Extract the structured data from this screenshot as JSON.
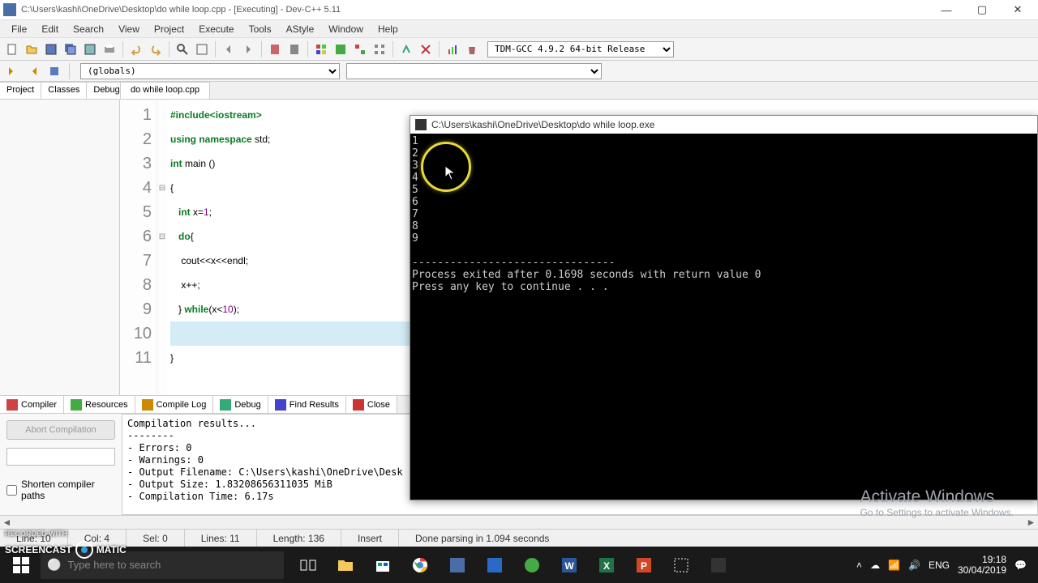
{
  "title": "C:\\Users\\kashi\\OneDrive\\Desktop\\do while loop.cpp - [Executing] - Dev-C++ 5.11",
  "menus": [
    "File",
    "Edit",
    "Search",
    "View",
    "Project",
    "Execute",
    "Tools",
    "AStyle",
    "Window",
    "Help"
  ],
  "compiler_select": "TDM-GCC 4.9.2 64-bit Release",
  "globals": "(globals)",
  "left_tabs": [
    "Project",
    "Classes",
    "Debug"
  ],
  "editor_tab": "do while loop.cpp",
  "code": {
    "lines": [
      {
        "n": "1",
        "html": "<span class='pp'>#include&lt;iostream&gt;</span>"
      },
      {
        "n": "2",
        "html": "<span class='kw'>using</span> <span class='kw'>namespace</span> std;"
      },
      {
        "n": "3",
        "html": "<span class='kw'>int</span> main ()"
      },
      {
        "n": "4",
        "html": "{",
        "fold": "⊟"
      },
      {
        "n": "5",
        "html": "   <span class='kw'>int</span> x=<span class='num'>1</span>;"
      },
      {
        "n": "6",
        "html": "   <span class='kw'>do</span>{",
        "fold": "⊟"
      },
      {
        "n": "7",
        "html": "    cout&lt;&lt;x&lt;&lt;endl;"
      },
      {
        "n": "8",
        "html": "    x++;"
      },
      {
        "n": "9",
        "html": "   } <span class='kw'>while</span>(x&lt;<span class='num'>10</span>);"
      },
      {
        "n": "10",
        "html": "",
        "current": true
      },
      {
        "n": "11",
        "html": "}"
      }
    ]
  },
  "console": {
    "title": "C:\\Users\\kashi\\OneDrive\\Desktop\\do while loop.exe",
    "body": "1\n2\n3\n4\n5\n6\n7\n8\n9\n\n--------------------------------\nProcess exited after 0.1698 seconds with return value 0\nPress any key to continue . . ."
  },
  "bottom_tabs": [
    "Compiler",
    "Resources",
    "Compile Log",
    "Debug",
    "Find Results",
    "Close"
  ],
  "abort_label": "Abort Compilation",
  "shorten_label": "Shorten compiler paths",
  "compile_log": "Compilation results...\n--------\n- Errors: 0\n- Warnings: 0\n- Output Filename: C:\\Users\\kashi\\OneDrive\\Desk\n- Output Size: 1.83208656311035 MiB\n- Compilation Time: 6.17s",
  "status": {
    "line": "Line:   10",
    "col": "Col:   4",
    "sel": "Sel:   0",
    "lines": "Lines:   11",
    "length": "Length:   136",
    "mode": "Insert",
    "parse": "Done parsing in 1.094 seconds"
  },
  "watermark": {
    "l1": "Activate Windows",
    "l2": "Go to Settings to activate Windows."
  },
  "screencast_prefix": "RECORDED WITH",
  "screencast1": "SCREENCAST",
  "screencast2": "MATIC",
  "search_placeholder": "Type here to search",
  "clock": {
    "time": "19:18",
    "date": "30/04/2019"
  }
}
